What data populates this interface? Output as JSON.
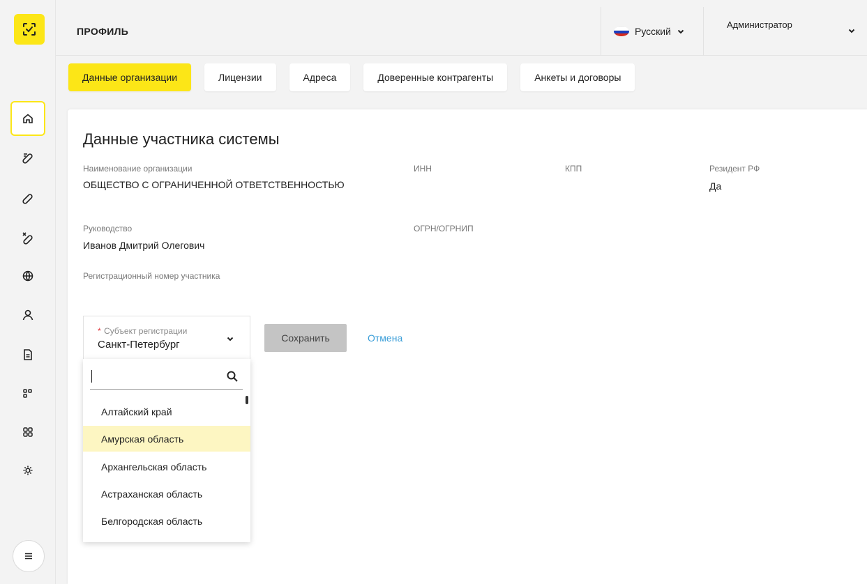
{
  "header": {
    "page_title": "ПРОФИЛЬ",
    "language": "Русский",
    "user": "Администратор"
  },
  "tabs": [
    {
      "label": "Данные организации",
      "active": true
    },
    {
      "label": "Лицензии",
      "active": false
    },
    {
      "label": "Адреса",
      "active": false
    },
    {
      "label": "Доверенные контрагенты",
      "active": false
    },
    {
      "label": "Анкеты и договоры",
      "active": false
    }
  ],
  "sidebar": {
    "items": [
      "home-icon",
      "pill-tag-icon",
      "pill-icon",
      "pill-cross-icon",
      "globe-icon",
      "user-icon",
      "document-icon",
      "apps-icon",
      "grid-icon",
      "settings-icon"
    ]
  },
  "card": {
    "title": "Данные участника системы",
    "fields": {
      "org_name_label": "Наименование организации",
      "org_name_value": "ОБЩЕСТВО С ОГРАНИЧЕННОЙ ОТВЕТСТВЕННОСТЬЮ",
      "inn_label": "ИНН",
      "kpp_label": "КПП",
      "resident_label": "Резидент РФ",
      "resident_value": "Да",
      "management_label": "Руководство",
      "management_value": "Иванов Дмитрий Олегович",
      "ogrn_label": "ОГРН/ОГРНИП",
      "reg_number_label": "Регистрационный номер участника"
    },
    "subject": {
      "required_mark": "*",
      "label": "Субъект регистрации",
      "value": "Санкт-Петербург"
    },
    "save_label": "Сохранить",
    "cancel_label": "Отмена"
  },
  "dropdown": {
    "search_value": "",
    "options": [
      {
        "label": "Алтайский край",
        "highlighted": false
      },
      {
        "label": "Амурская область",
        "highlighted": true
      },
      {
        "label": "Архангельская область",
        "highlighted": false
      },
      {
        "label": "Астраханская область",
        "highlighted": false
      },
      {
        "label": "Белгородская область",
        "highlighted": false
      }
    ]
  },
  "colors": {
    "accent": "#fce617",
    "link": "#3b9ed8",
    "required": "#e0393e",
    "highlight": "#fdf6c2"
  }
}
